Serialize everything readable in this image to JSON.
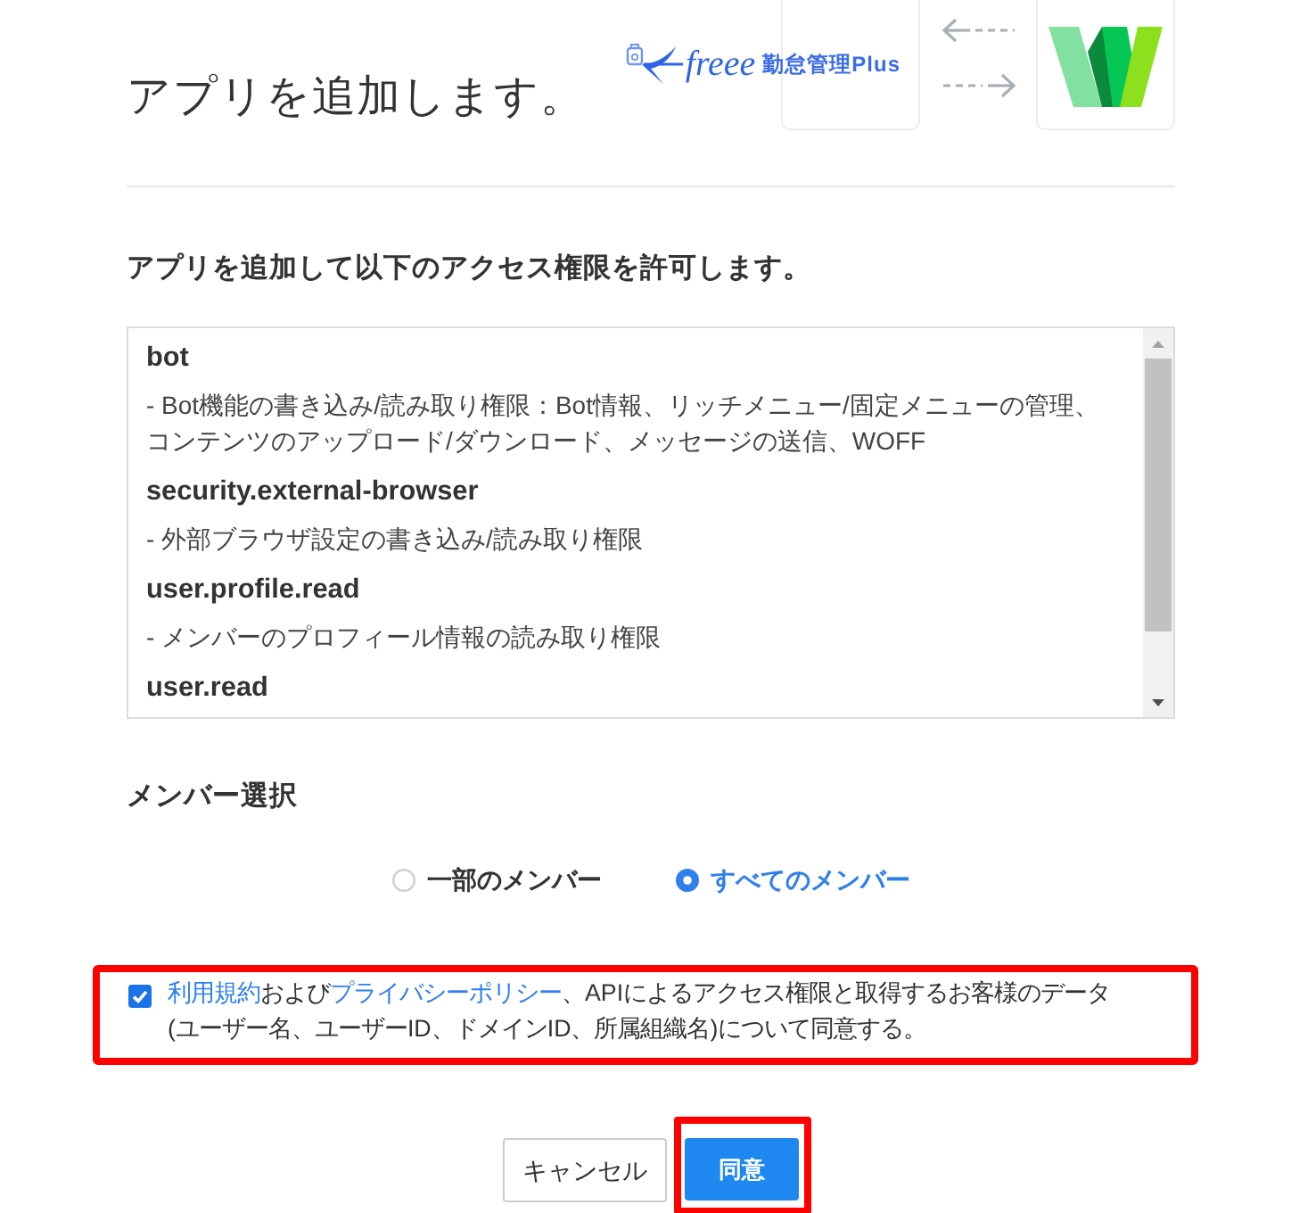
{
  "header": {
    "title": "アプリを追加します。",
    "logo": {
      "brand": "freee",
      "product": "勤怠管理Plus"
    }
  },
  "permissions": {
    "heading": "アプリを追加して以下のアクセス権限を許可します。",
    "scopes": [
      {
        "name": "bot",
        "description_lines": [
          "- Bot機能の書き込み/読み取り権限：Bot情報、リッチメニュー/固定メニューの管理、",
          "コンテンツのアップロード/ダウンロード、メッセージの送信、WOFF"
        ]
      },
      {
        "name": "security.external-browser",
        "description_lines": [
          "- 外部ブラウザ設定の書き込み/読み取り権限"
        ]
      },
      {
        "name": "user.profile.read",
        "description_lines": [
          "- メンバーのプロフィール情報の読み取り権限"
        ]
      },
      {
        "name": "user.read"
      }
    ]
  },
  "members": {
    "heading": "メンバー選択",
    "options": [
      {
        "label": "一部のメンバー",
        "selected": false
      },
      {
        "label": "すべてのメンバー",
        "selected": true
      }
    ]
  },
  "consent": {
    "checked": true,
    "highlighted": true,
    "parts": [
      {
        "kind": "link",
        "text": "利用規約"
      },
      {
        "kind": "text",
        "text": "および"
      },
      {
        "kind": "link",
        "text": "プライバシーポリシー"
      },
      {
        "kind": "text",
        "text": "、APIによるアクセス権限と取得するお客様のデータ(ユーザー名、ユーザーID、ドメインID、所属組織名)について同意する。"
      }
    ]
  },
  "buttons": [
    {
      "label": "キャンセル",
      "kind": "secondary",
      "highlighted": false
    },
    {
      "label": "同意",
      "kind": "primary",
      "highlighted": true
    }
  ]
}
